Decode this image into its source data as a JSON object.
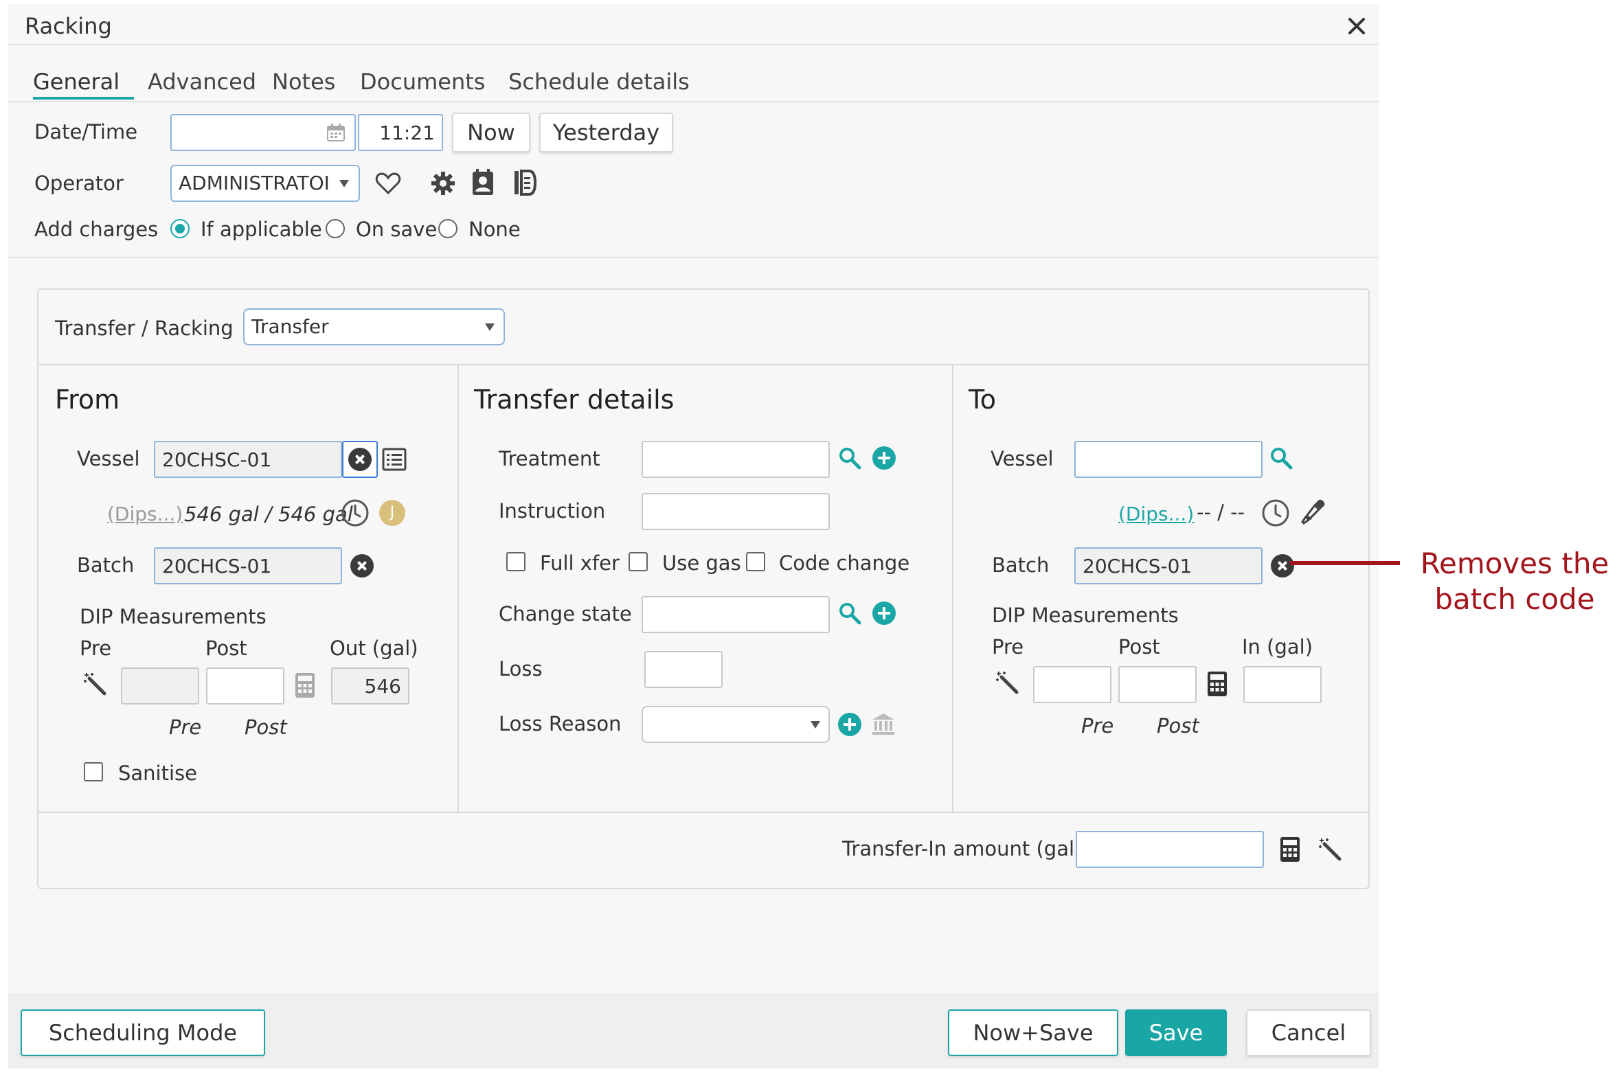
{
  "dialog": {
    "title": "Racking",
    "tabs": [
      "General",
      "Advanced",
      "Notes",
      "Documents",
      "Schedule details"
    ],
    "active_tab": "General"
  },
  "general": {
    "datetime_label": "Date/Time",
    "date_value": "",
    "time_value": "11:21",
    "now_label": "Now",
    "yesterday_label": "Yesterday",
    "operator_label": "Operator",
    "operator_value": "ADMINISTRATOI",
    "add_charges_label": "Add charges",
    "charges_options": [
      "If applicable",
      "On save",
      "None"
    ],
    "charges_selected": "If applicable"
  },
  "transfer": {
    "type_label": "Transfer / Racking",
    "type_value": "Transfer"
  },
  "from": {
    "heading": "From",
    "vessel_label": "Vessel",
    "vessel_value": "20CHSC-01",
    "dips_link": "(Dips...)",
    "volume_text": "546 gal / 546 gal",
    "badge": "J",
    "batch_label": "Batch",
    "batch_value": "20CHCS-01",
    "dip_label": "DIP Measurements",
    "pre_label": "Pre",
    "post_label": "Post",
    "out_label": "Out (gal)",
    "pre_value": "",
    "post_value": "",
    "out_value": "546",
    "pre_italic": "Pre",
    "post_italic": "Post",
    "sanitise_label": "Sanitise"
  },
  "details": {
    "heading": "Transfer details",
    "treatment_label": "Treatment",
    "instruction_label": "Instruction",
    "full_xfer_label": "Full xfer",
    "use_gas_label": "Use gas",
    "code_change_label": "Code change",
    "change_state_label": "Change state",
    "loss_label": "Loss",
    "loss_reason_label": "Loss Reason"
  },
  "to": {
    "heading": "To",
    "vessel_label": "Vessel",
    "vessel_value": "",
    "dips_link": "(Dips...)",
    "volume_text": "-- / --",
    "batch_label": "Batch",
    "batch_value": "20CHCS-01",
    "dip_label": "DIP Measurements",
    "pre_label": "Pre",
    "post_label": "Post",
    "in_label": "In (gal)",
    "pre_italic": "Pre",
    "post_italic": "Post"
  },
  "transfer_in": {
    "label": "Transfer-In amount (gal)",
    "value": ""
  },
  "footer": {
    "scheduling_mode": "Scheduling Mode",
    "now_save": "Now+Save",
    "save": "Save",
    "cancel": "Cancel"
  },
  "annotation": {
    "line1": "Removes the",
    "line2": "batch code"
  },
  "colors": {
    "accent": "#1aa6a5",
    "annotation": "#a3151d",
    "input_border_blue": "#8fb3d9"
  }
}
